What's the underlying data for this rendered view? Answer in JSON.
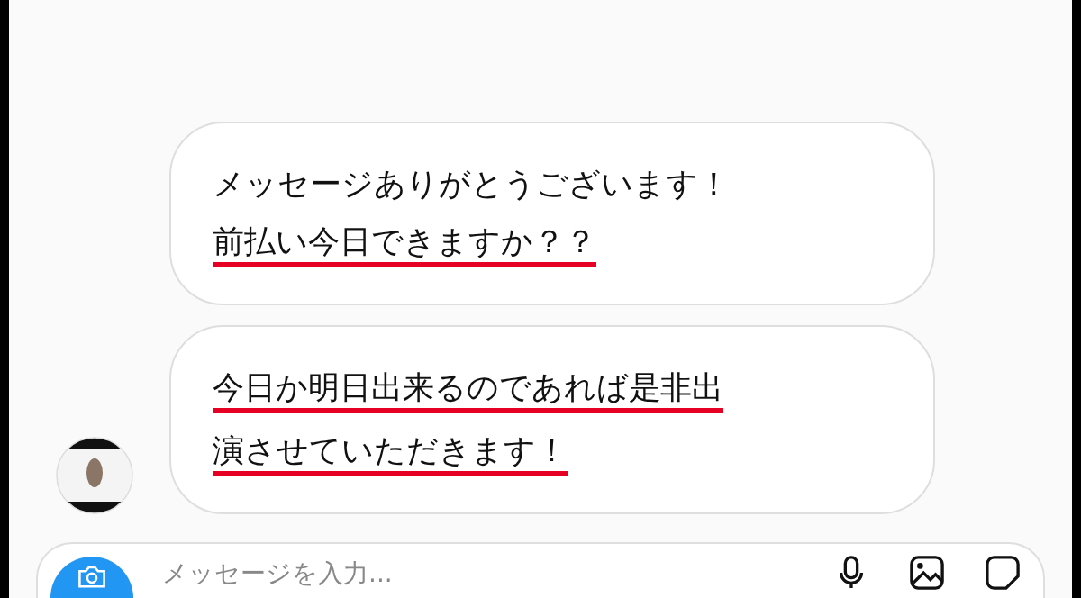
{
  "messages": [
    {
      "lines": [
        {
          "text": "メッセージありがとうございます！",
          "underlined": false
        },
        {
          "text": "前払い今日できますか？？",
          "underlined": true
        }
      ],
      "avatar": false
    },
    {
      "lines": [
        {
          "text": "今日か明日出来るのであれば是非出",
          "underlined": true
        },
        {
          "text": "演させていただきます！",
          "underlined": true
        }
      ],
      "avatar": true
    }
  ],
  "composer": {
    "placeholder": "メッセージを入力..."
  }
}
